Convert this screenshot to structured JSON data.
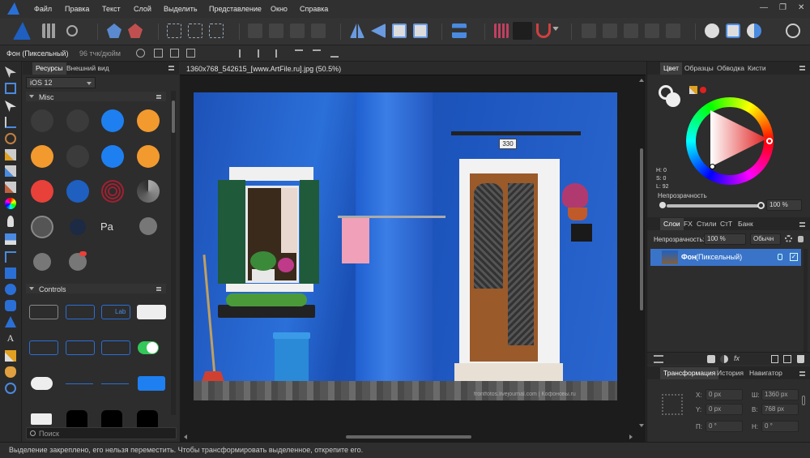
{
  "menu": {
    "items": [
      "Файл",
      "Правка",
      "Текст",
      "Слой",
      "Выделить",
      "Представление",
      "Окно",
      "Справка"
    ]
  },
  "context": {
    "layer_name": "Фон (Пиксельный)",
    "dpi": "96 тчк/дюйм"
  },
  "assets_panel": {
    "tabs": [
      "Ресурсы",
      "Внешний вид"
    ],
    "preset": "iOS 12",
    "section_misc": "Misc",
    "section_controls": "Controls",
    "search_placeholder": "Поиск",
    "control_label": "Lab"
  },
  "document": {
    "tab_title": "1360x768_542615_[www.ArtFile.ru].jpg (50.5%)",
    "house_number": "330",
    "watermark": "frontfotos.livejournal.com | Кофоновы.ru"
  },
  "color_panel": {
    "tabs": [
      "Цвет",
      "Образцы",
      "Обводка",
      "Кисти"
    ],
    "h": "H: 0",
    "s": "S: 0",
    "l": "L: 92",
    "opacity_label": "Непрозрачность",
    "opacity_value": "100 %",
    "accent": "#e02020"
  },
  "layers_panel": {
    "tabs": [
      "Слои",
      "FX",
      "Стили",
      "СтТ",
      "Банк"
    ],
    "opacity_label": "Непрозрачность:",
    "opacity_value": "100 %",
    "blend_mode": "Обычн",
    "layer_name": "Фон",
    "layer_type": "(Пиксельный)"
  },
  "transform_panel": {
    "tabs": [
      "Трансформация",
      "История",
      "Навигатор"
    ],
    "x_label": "X:",
    "x_value": "0 px",
    "y_label": "Y:",
    "y_value": "0 px",
    "w_label": "Ш:",
    "w_value": "1360 px",
    "h_label": "В:",
    "h_value": "768 px",
    "r_label": "П:",
    "r_value": "0 °",
    "s_label": "Н:",
    "s_value": "0 °"
  },
  "status": {
    "text": "Выделение закреплено, его нельзя переместить. Чтобы трансформировать выделенное, открепите его."
  }
}
